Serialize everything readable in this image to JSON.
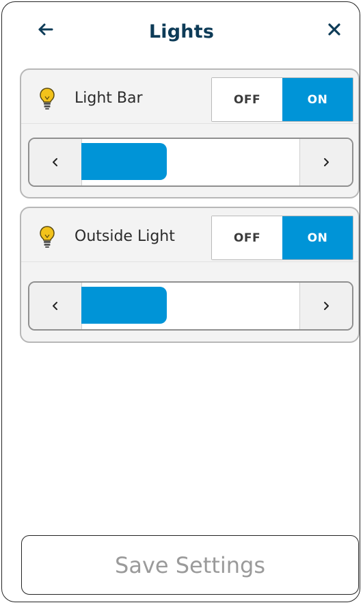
{
  "header": {
    "title": "Lights",
    "back_icon": "arrow-left-icon",
    "close_icon": "close-icon"
  },
  "colors": {
    "accent": "#0094d7",
    "title": "#0d3b57",
    "bulb": "#f2c21b",
    "disabled_text": "#9a9a9a"
  },
  "lights": [
    {
      "name": "Light Bar",
      "icon": "lightbulb-icon",
      "toggle": {
        "off_label": "OFF",
        "on_label": "ON",
        "state": "on"
      },
      "brightness_fraction": 0.39
    },
    {
      "name": "Outside Light",
      "icon": "lightbulb-icon",
      "toggle": {
        "off_label": "OFF",
        "on_label": "ON",
        "state": "on"
      },
      "brightness_fraction": 0.39
    }
  ],
  "slider_icons": {
    "decrease": "chevron-left-icon",
    "increase": "chevron-right-icon"
  },
  "footer": {
    "save_label": "Save Settings",
    "save_enabled": false
  }
}
